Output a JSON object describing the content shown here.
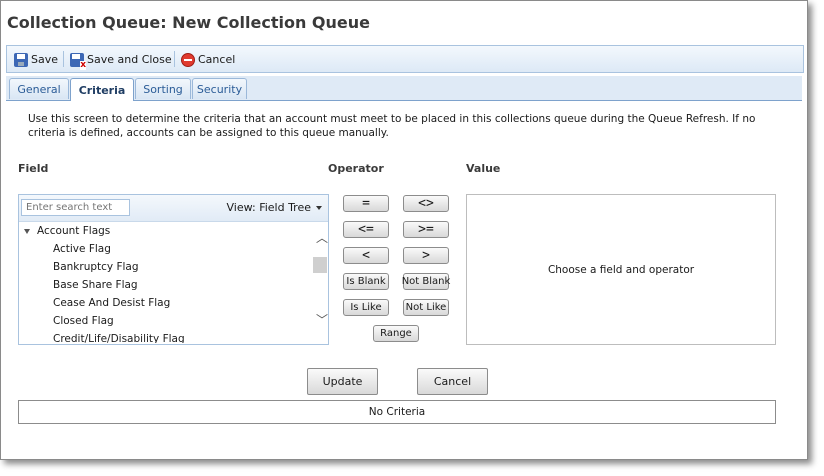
{
  "page": {
    "title": "Collection Queue: New Collection Queue"
  },
  "toolbar": {
    "save_label": "Save",
    "save_close_label": "Save and Close",
    "cancel_label": "Cancel"
  },
  "tabs": [
    {
      "label": "General",
      "active": false
    },
    {
      "label": "Criteria",
      "active": true
    },
    {
      "label": "Sorting",
      "active": false
    },
    {
      "label": "Security",
      "active": false
    }
  ],
  "criteria_tab": {
    "description": "Use this screen to determine the criteria that an account must meet to be placed in this collections queue during the Queue Refresh. If no criteria is defined, accounts can be assigned to this queue manually.",
    "field_header": "Field",
    "operator_header": "Operator",
    "value_header": "Value",
    "search_placeholder": "Enter search text",
    "view_label": "View: Field Tree",
    "tree": {
      "parent": "Account Flags",
      "children": [
        "Active Flag",
        "Bankruptcy Flag",
        "Base Share Flag",
        "Cease And Desist Flag",
        "Closed Flag",
        "Credit/Life/Disability Flag"
      ]
    },
    "operators": {
      "equals": "=",
      "not_equals": "<>",
      "less_equal": "<=",
      "greater_equal": ">=",
      "less": "<",
      "greater": ">",
      "is_blank": "Is Blank",
      "not_blank": "Not Blank",
      "is_like": "Is Like",
      "not_like": "Not Like",
      "range": "Range"
    },
    "value_placeholder": "Choose a field and operator",
    "update_label": "Update",
    "cancel_label": "Cancel",
    "criteria_status": "No Criteria"
  }
}
